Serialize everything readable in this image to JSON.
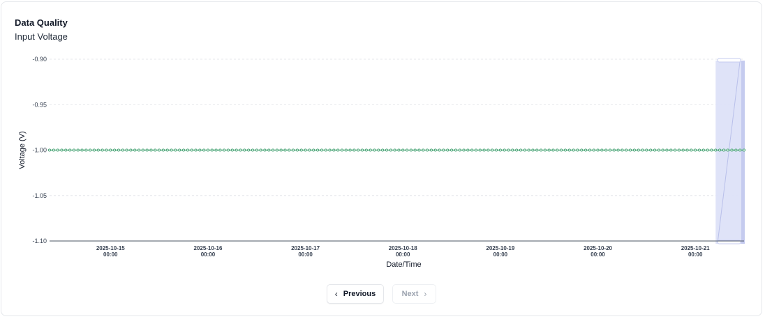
{
  "card": {
    "title": "Data Quality",
    "subtitle": "Input Voltage"
  },
  "chart_data": {
    "type": "line",
    "xlabel": "Date/Time",
    "ylabel": "Voltage (V)",
    "ylim": [
      -1.1,
      -0.9
    ],
    "y_ticks": [
      "-0.90",
      "-0.95",
      "-1.00",
      "-1.05",
      "-1.10"
    ],
    "x_ticks": [
      {
        "date": "2025-10-15",
        "time": "00:00"
      },
      {
        "date": "2025-10-16",
        "time": "00:00"
      },
      {
        "date": "2025-10-17",
        "time": "00:00"
      },
      {
        "date": "2025-10-18",
        "time": "00:00"
      },
      {
        "date": "2025-10-19",
        "time": "00:00"
      },
      {
        "date": "2025-10-20",
        "time": "00:00"
      },
      {
        "date": "2025-10-21",
        "time": "00:00"
      }
    ],
    "xlim": [
      "2025-10-14 09:00",
      "2025-10-21 12:00"
    ],
    "grid": true,
    "series": [
      {
        "color": "#3f9f6e",
        "x_start": "2025-10-14 09:00",
        "x_end": "2025-10-21 12:00",
        "interval_minutes": 60,
        "y": -1.0
      }
    ],
    "brush": {
      "start": "2025-10-21 05:00",
      "end": "2025-10-21 12:00"
    }
  },
  "pagination": {
    "previous_label": "Previous",
    "next_label": "Next",
    "next_disabled": true
  },
  "colors": {
    "line": "#3f9f6e",
    "brush_fill": "#dde1f8",
    "brush_edge": "#c5cbef",
    "grid": "#e5e7eb"
  }
}
